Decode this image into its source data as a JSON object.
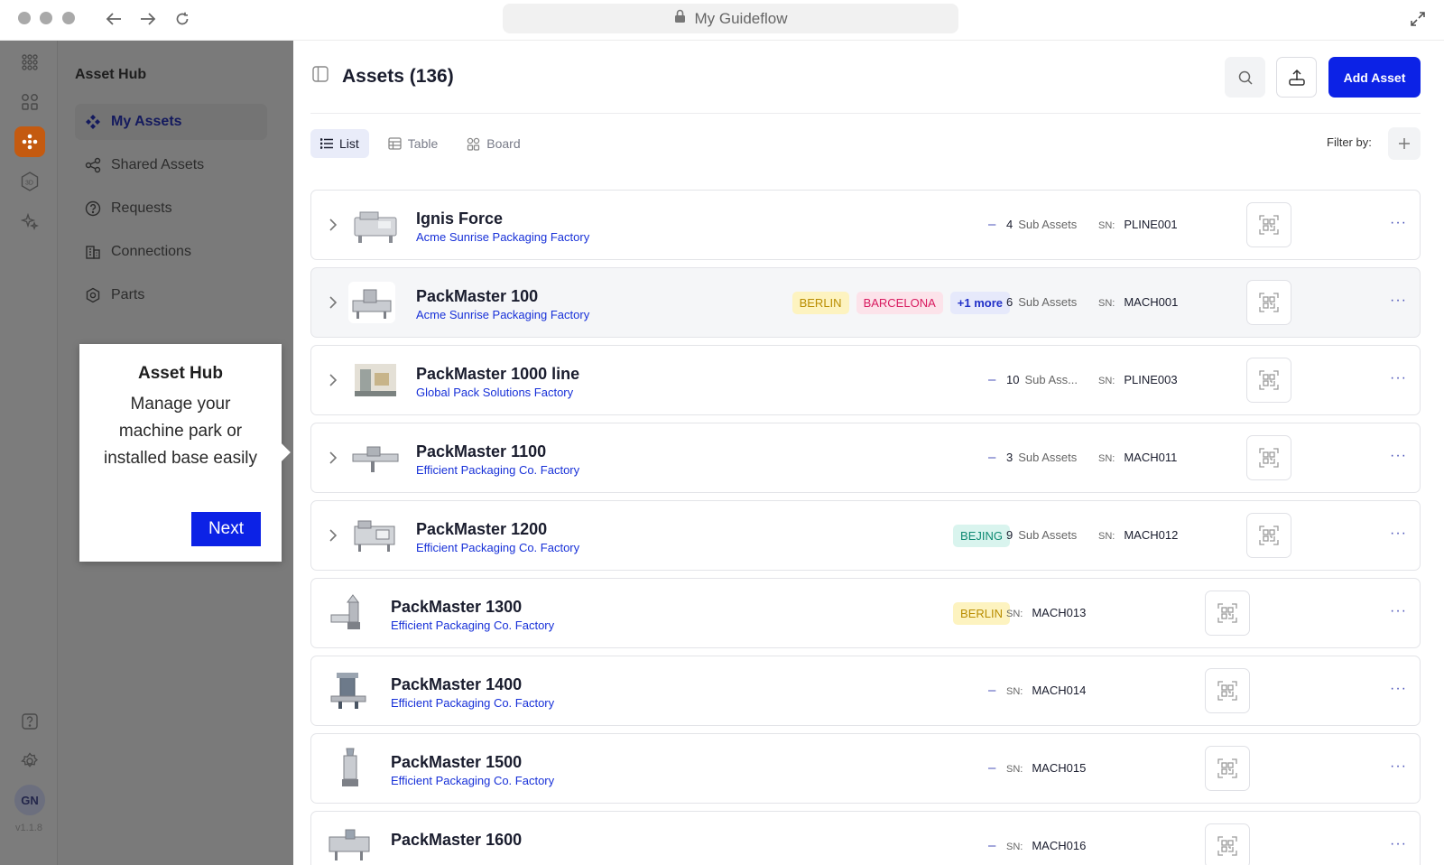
{
  "browser": {
    "url_title": "My Guideflow"
  },
  "rail": {
    "avatar_initials": "GN",
    "version": "v1.1.8"
  },
  "sidebar": {
    "title": "Asset Hub",
    "items": [
      {
        "label": "My Assets",
        "icon": "grid-diamond-icon",
        "active": true
      },
      {
        "label": "Shared Assets",
        "icon": "share-icon"
      },
      {
        "label": "Requests",
        "icon": "question-circle-icon"
      },
      {
        "label": "Connections",
        "icon": "building-icon"
      },
      {
        "label": "Parts",
        "icon": "hex-gear-icon"
      }
    ]
  },
  "guide": {
    "title": "Asset Hub",
    "text": "Manage your machine park or installed base easily",
    "next_label": "Next"
  },
  "header": {
    "title": "Assets (136)",
    "add_label": "Add Asset"
  },
  "views": {
    "list": "List",
    "table": "Table",
    "board": "Board"
  },
  "filter": {
    "label": "Filter by:"
  },
  "labels": {
    "sub_assets": "Sub Assets",
    "sn": "SN:"
  },
  "assets": [
    {
      "name": "Ignis Force",
      "location": "Acme Sunrise Packaging Factory",
      "dash": "–",
      "sub_count": "4",
      "sub_label": "Sub Assets",
      "sn": "PLINE001"
    },
    {
      "name": "PackMaster 100",
      "location": "Acme Sunrise Packaging Factory",
      "tags": [
        "BERLIN",
        "BARCELONA",
        "+1 more"
      ],
      "sub_count": "6",
      "sub_label": "Sub Assets",
      "sn": "MACH001"
    },
    {
      "name": "PackMaster 1000 line",
      "location": "Global Pack Solutions Factory",
      "dash": "–",
      "sub_count": "10",
      "sub_label": "Sub Ass...",
      "sn": "PLINE003"
    },
    {
      "name": "PackMaster 1100",
      "location": "Efficient Packaging Co. Factory",
      "dash": "–",
      "sub_count": "3",
      "sub_label": "Sub Assets",
      "sn": "MACH011"
    },
    {
      "name": "PackMaster 1200",
      "location": "Efficient Packaging Co. Factory",
      "tags": [
        "BEJING"
      ],
      "sub_count": "9",
      "sub_label": "Sub Assets",
      "sn": "MACH012"
    },
    {
      "name": "PackMaster 1300",
      "location": "Efficient Packaging Co. Factory",
      "tags": [
        "BERLIN"
      ],
      "sn": "MACH013"
    },
    {
      "name": "PackMaster 1400",
      "location": "Efficient Packaging Co. Factory",
      "dash": "–",
      "sn": "MACH014"
    },
    {
      "name": "PackMaster 1500",
      "location": "Efficient Packaging Co. Factory",
      "dash": "–",
      "sn": "MACH015"
    },
    {
      "name": "PackMaster 1600",
      "location": "",
      "dash": "–",
      "sn": "MACH016"
    }
  ],
  "colors": {
    "brand_blue": "#0c22e6",
    "rail_active": "#c45a10",
    "link_blue": "#1730d8"
  }
}
